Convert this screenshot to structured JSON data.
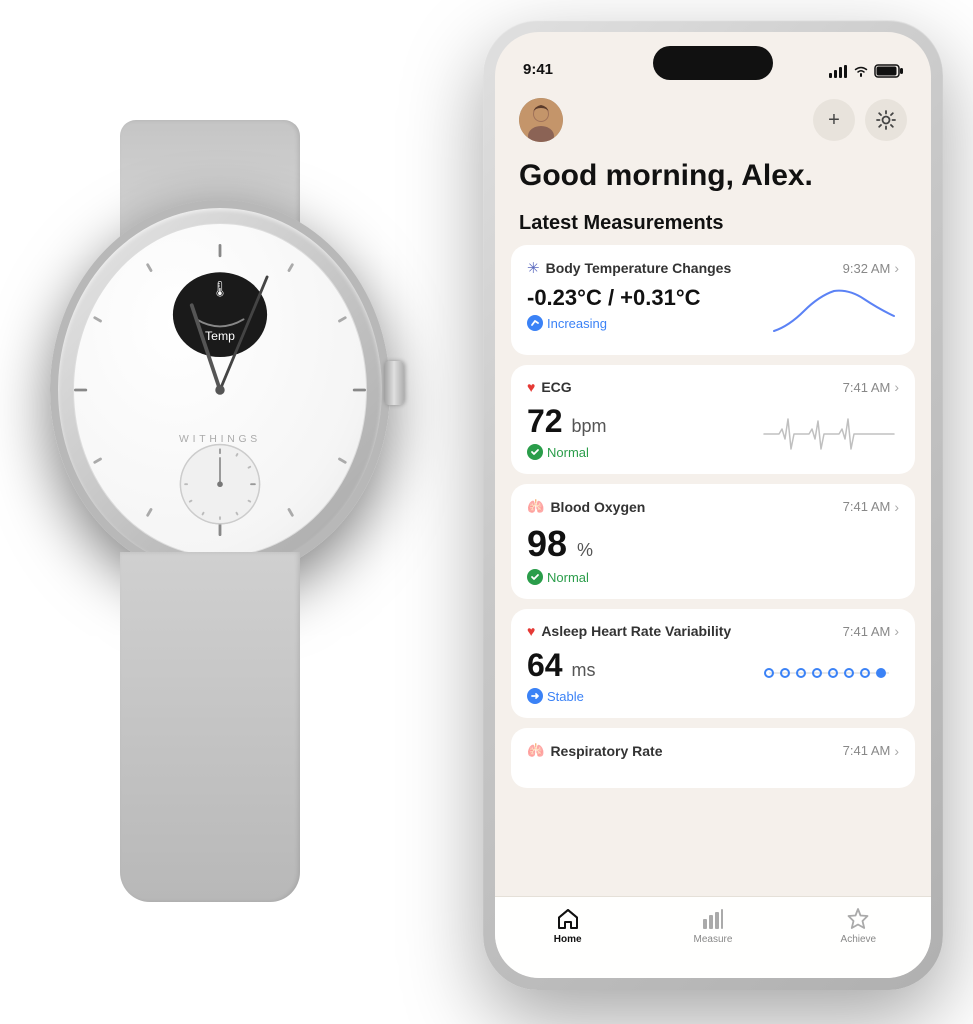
{
  "watch": {
    "brand": "WITHINGS",
    "temp_label": "Temp"
  },
  "phone": {
    "status_bar": {
      "time": "9:41"
    },
    "header": {
      "greeting": "Good morning, Alex.",
      "plus_button": "+",
      "settings_button": "⊙"
    },
    "section_title": "Latest Measurements",
    "measurements": [
      {
        "id": "body-temp",
        "icon": "✳",
        "icon_color": "#5b6abf",
        "title": "Body Temperature Changes",
        "time": "9:32 AM",
        "value": "-0.23°C / +0.31°C",
        "status_icon": "↑",
        "status_text": "Increasing",
        "status_color": "blue",
        "chart_type": "curve"
      },
      {
        "id": "ecg",
        "icon": "♥",
        "icon_color": "#e53935",
        "title": "ECG",
        "time": "7:41 AM",
        "value": "72",
        "unit": "bpm",
        "status_icon": "✓",
        "status_text": "Normal",
        "status_color": "green",
        "chart_type": "ecg"
      },
      {
        "id": "blood-oxygen",
        "icon": "🫁",
        "icon_color": "#5b6abf",
        "title": "Blood Oxygen",
        "time": "7:41 AM",
        "value": "98",
        "unit": "%",
        "status_icon": "✓",
        "status_text": "Normal",
        "status_color": "green",
        "chart_type": "none"
      },
      {
        "id": "hrv",
        "icon": "♥",
        "icon_color": "#e53935",
        "title": "Asleep Heart Rate Variability",
        "time": "7:41 AM",
        "value": "64",
        "unit": "ms",
        "status_icon": "→",
        "status_text": "Stable",
        "status_color": "blue",
        "chart_type": "dots"
      },
      {
        "id": "respiratory",
        "icon": "🫁",
        "icon_color": "#5b6abf",
        "title": "Respiratory Rate",
        "time": "7:41 AM",
        "value": "",
        "unit": "",
        "chart_type": "none"
      }
    ],
    "nav": {
      "items": [
        {
          "label": "Home",
          "icon": "⌂",
          "active": true
        },
        {
          "label": "Measure",
          "icon": "📊",
          "active": false
        },
        {
          "label": "Achieve",
          "icon": "★",
          "active": false
        }
      ]
    }
  }
}
